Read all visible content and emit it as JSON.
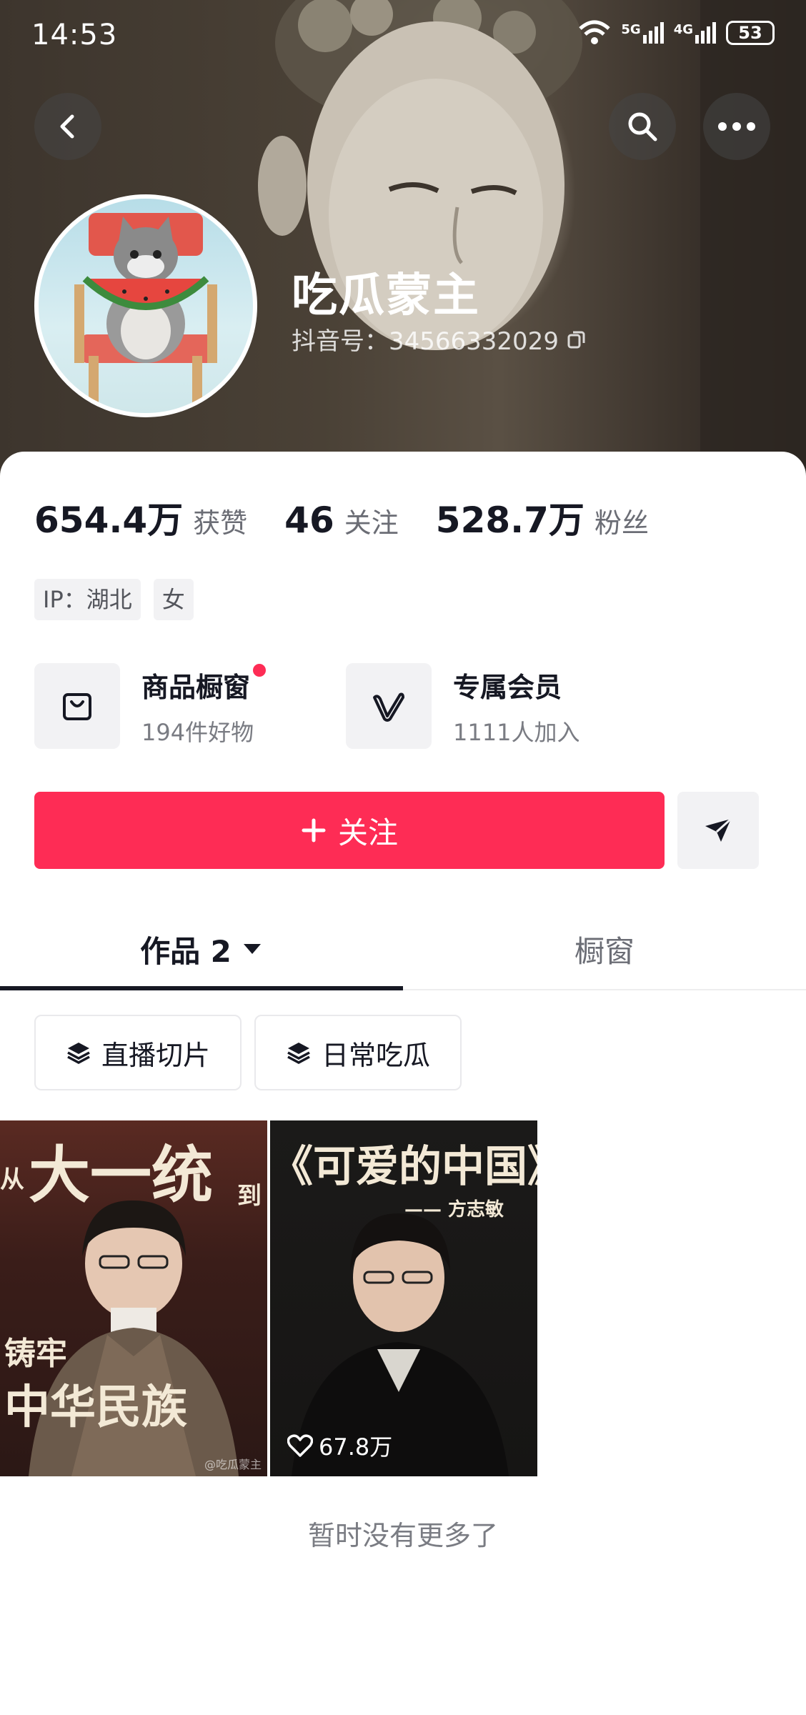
{
  "status_bar": {
    "time": "14:53",
    "signal_1": "5G",
    "signal_2": "4G",
    "battery": "53"
  },
  "profile": {
    "name": "吃瓜蒙主",
    "douyin_id": "抖音号：34566332029",
    "stats": [
      {
        "value": "654.4万",
        "label": "获赞"
      },
      {
        "value": "46",
        "label": "关注"
      },
      {
        "value": "528.7万",
        "label": "粉丝"
      }
    ],
    "tags": [
      "IP：湖北",
      "女"
    ]
  },
  "features": {
    "shop": {
      "title": "商品橱窗",
      "subtitle": "194件好物"
    },
    "member": {
      "title": "专属会员",
      "subtitle": "1111人加入"
    }
  },
  "actions": {
    "follow_label": "关注"
  },
  "tabs": {
    "works": "作品 2",
    "showcase": "橱窗"
  },
  "collections": [
    "直播切片",
    "日常吃瓜"
  ],
  "videos": [
    {
      "overlay_small": "从",
      "overlay_big": "大一统",
      "overlay_small2": "到",
      "overlay_bottom1": "铸牢",
      "overlay_bottom2": "中华民族",
      "watermark": "@吃瓜蒙主"
    },
    {
      "overlay_title": "《可爱的中国》",
      "overlay_author": "—— 方志敏",
      "likes": "67.8万"
    }
  ],
  "end_note": "暂时没有更多了",
  "colors": {
    "accent": "#fe2c55",
    "text_primary": "#161823",
    "text_secondary": "#6b6d75",
    "chip_bg": "#f2f2f4"
  }
}
